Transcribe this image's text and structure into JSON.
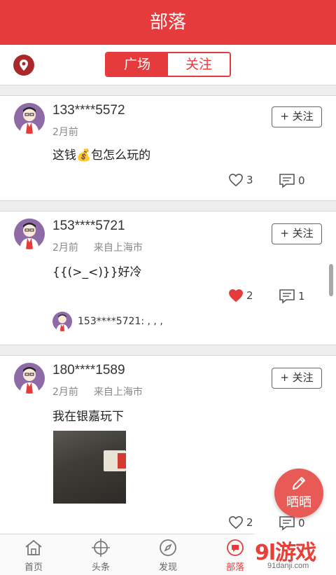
{
  "header": {
    "title": "部落"
  },
  "subbar": {
    "tabs": [
      {
        "label": "广场",
        "active": true
      },
      {
        "label": "关注",
        "active": false
      }
    ],
    "accent": "#e53b3d"
  },
  "posts": [
    {
      "name": "133****5572",
      "time": "2月前",
      "location": "",
      "content": "这钱💰包怎么玩的",
      "follow": "+ 关注",
      "likes": "3",
      "liked": false,
      "comments": "0",
      "reply": ""
    },
    {
      "name": "153****5721",
      "time": "2月前",
      "location": "来自上海市",
      "content": "{{(>_<)}}好冷",
      "follow": "+ 关注",
      "likes": "2",
      "liked": true,
      "comments": "1",
      "reply": "153****5721: , , ,"
    },
    {
      "name": "180****1589",
      "time": "2月前",
      "location": "来自上海市",
      "content": "我在银嘉玩下",
      "follow": "+ 关注",
      "likes": "2",
      "liked": false,
      "comments": "0",
      "reply": ""
    }
  ],
  "fab": {
    "label": "晒晒"
  },
  "tabbar": [
    {
      "label": "首页",
      "icon": "home-icon"
    },
    {
      "label": "头条",
      "icon": "target-icon"
    },
    {
      "label": "发现",
      "icon": "compass-icon"
    },
    {
      "label": "部落",
      "icon": "tribe-icon"
    }
  ],
  "watermark": {
    "brand": "9l游戏",
    "url": "91danji.com"
  }
}
